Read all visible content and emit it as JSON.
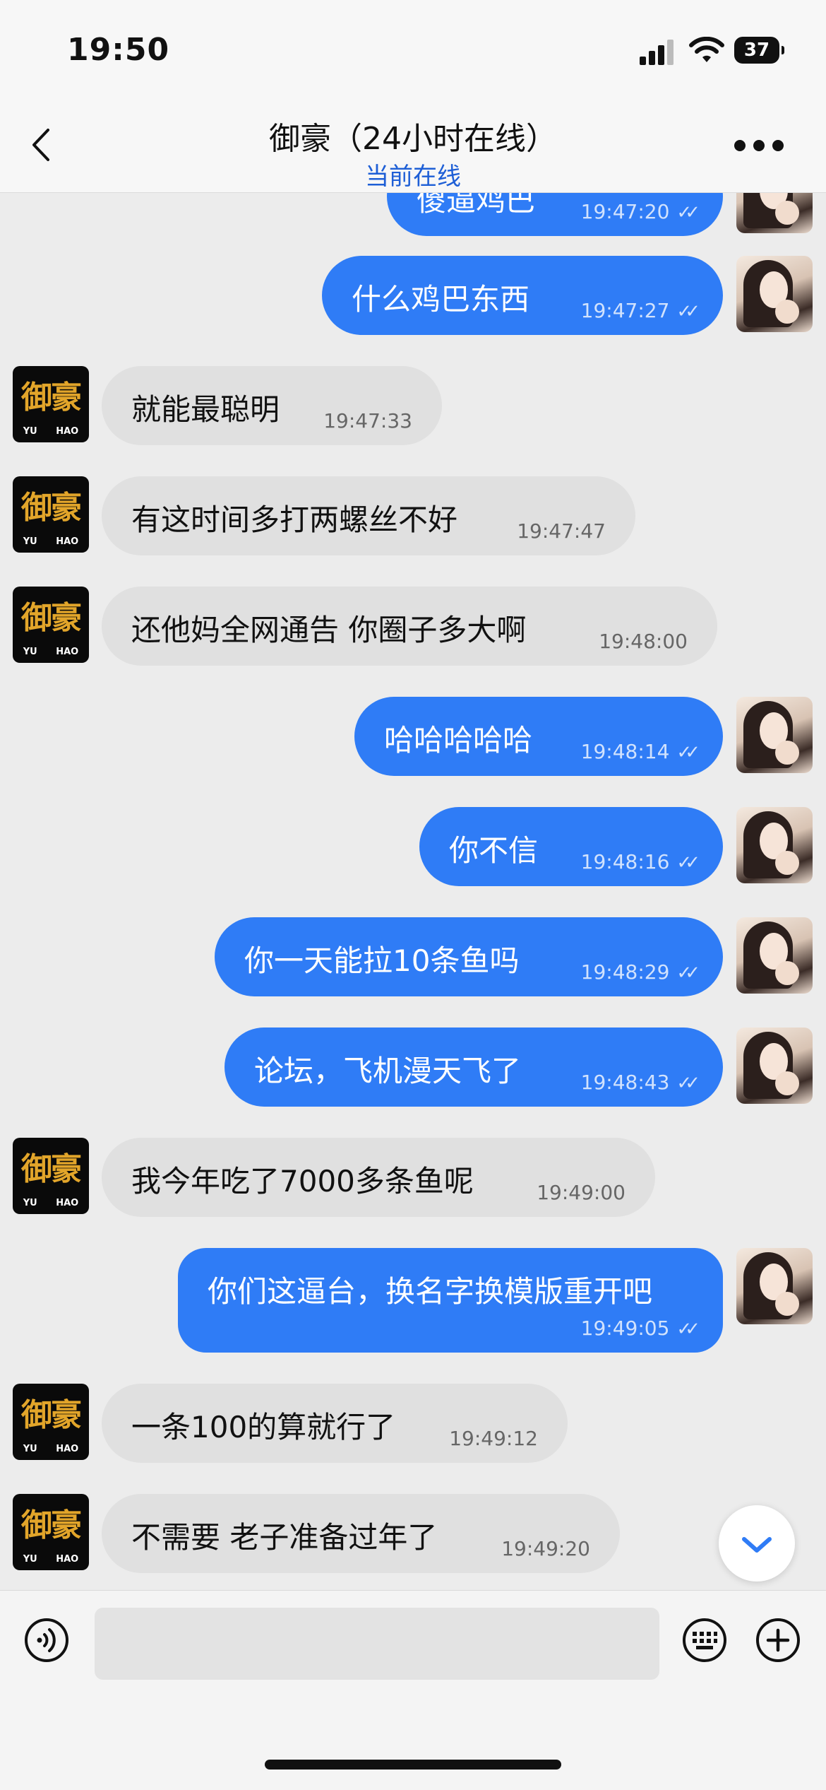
{
  "status_bar": {
    "time": "19:50",
    "battery": "37"
  },
  "header": {
    "title": "御豪（24小时在线）",
    "subtitle": "当前在线"
  },
  "contact_avatar": {
    "logo": "御豪",
    "logo_sub": "YU HAO"
  },
  "messages": [
    {
      "from": "me",
      "text": "傻逼鸡巴",
      "time": "19:47:20"
    },
    {
      "from": "me",
      "text": "什么鸡巴东西",
      "time": "19:47:27"
    },
    {
      "from": "them",
      "text": "就能最聪明",
      "time": "19:47:33"
    },
    {
      "from": "them",
      "text": "有这时间多打两螺丝不好",
      "time": "19:47:47"
    },
    {
      "from": "them",
      "text": "还他妈全网通告  你圈子多大啊",
      "time": "19:48:00"
    },
    {
      "from": "me",
      "text": "哈哈哈哈哈",
      "time": "19:48:14"
    },
    {
      "from": "me",
      "text": "你不信",
      "time": "19:48:16"
    },
    {
      "from": "me",
      "text": "你一天能拉10条鱼吗",
      "time": "19:48:29"
    },
    {
      "from": "me",
      "text": "论坛，飞机漫天飞了",
      "time": "19:48:43"
    },
    {
      "from": "them",
      "text": "我今年吃了7000多条鱼呢",
      "time": "19:49:00"
    },
    {
      "from": "me",
      "text": "你们这逼台，换名字换模版重开吧",
      "time": "19:49:05"
    },
    {
      "from": "them",
      "text": "一条100的算就行了",
      "time": "19:49:12"
    },
    {
      "from": "them",
      "text": "不需要  老子准备过年了",
      "time": "19:49:20"
    }
  ],
  "read_mark": "✓✓",
  "icons": {
    "back": "chevron-left-icon",
    "more": "more-dots-icon",
    "scroll": "chevron-down-icon",
    "voice": "voice-icon",
    "keyboard": "keyboard-icon",
    "plus": "plus-icon"
  },
  "colors": {
    "my_bubble": "#2f7cf6",
    "their_bubble": "#e0e0e0",
    "accent": "#1e5fd6"
  }
}
